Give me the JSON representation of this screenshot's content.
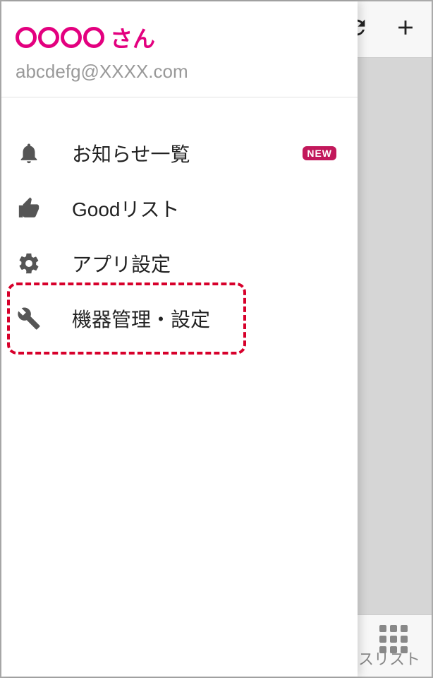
{
  "user": {
    "name_suffix": "さん",
    "email": "abcdefg@XXXX.com"
  },
  "menu": [
    {
      "id": "notifications",
      "label": "お知らせ一覧",
      "icon": "bell",
      "badge": "NEW"
    },
    {
      "id": "good-list",
      "label": "Goodリスト",
      "icon": "thumbs-up"
    },
    {
      "id": "app-settings",
      "label": "アプリ設定",
      "icon": "gear"
    },
    {
      "id": "device-mgmt",
      "label": "機器管理・設定",
      "icon": "wrench",
      "highlighted": true
    }
  ],
  "toolbar": {
    "refresh_label": "refresh",
    "add_label": "add"
  },
  "bottom": {
    "partial_text": "ビスリスト"
  }
}
